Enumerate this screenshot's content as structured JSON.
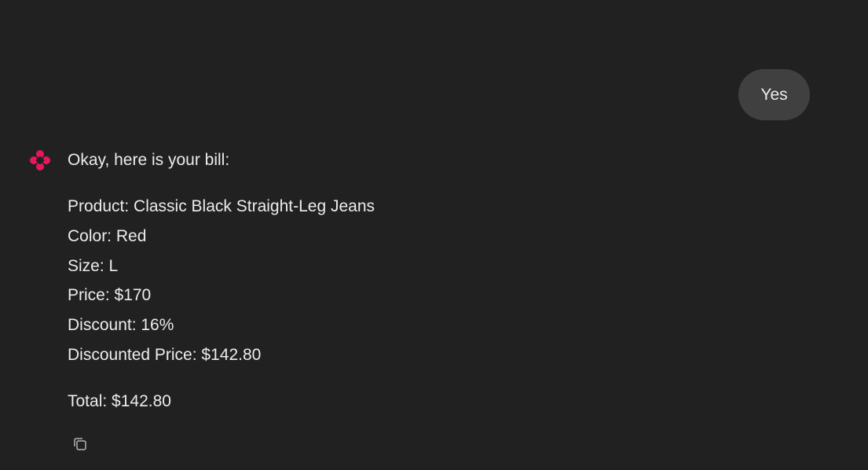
{
  "conversation": {
    "user_message": "Yes",
    "assistant": {
      "avatar_icon": "assistant-sparkle-icon",
      "accent_color": "#e8175d",
      "intro": "Okay, here is your bill:",
      "bill_lines": [
        "Product: Classic Black Straight-Leg Jeans",
        "Color: Red",
        "Size: L",
        "Price: $170",
        "Discount: 16%",
        "Discounted Price: $142.80"
      ],
      "total": "Total: $142.80",
      "actions": {
        "copy_icon": "copy-icon"
      }
    }
  }
}
